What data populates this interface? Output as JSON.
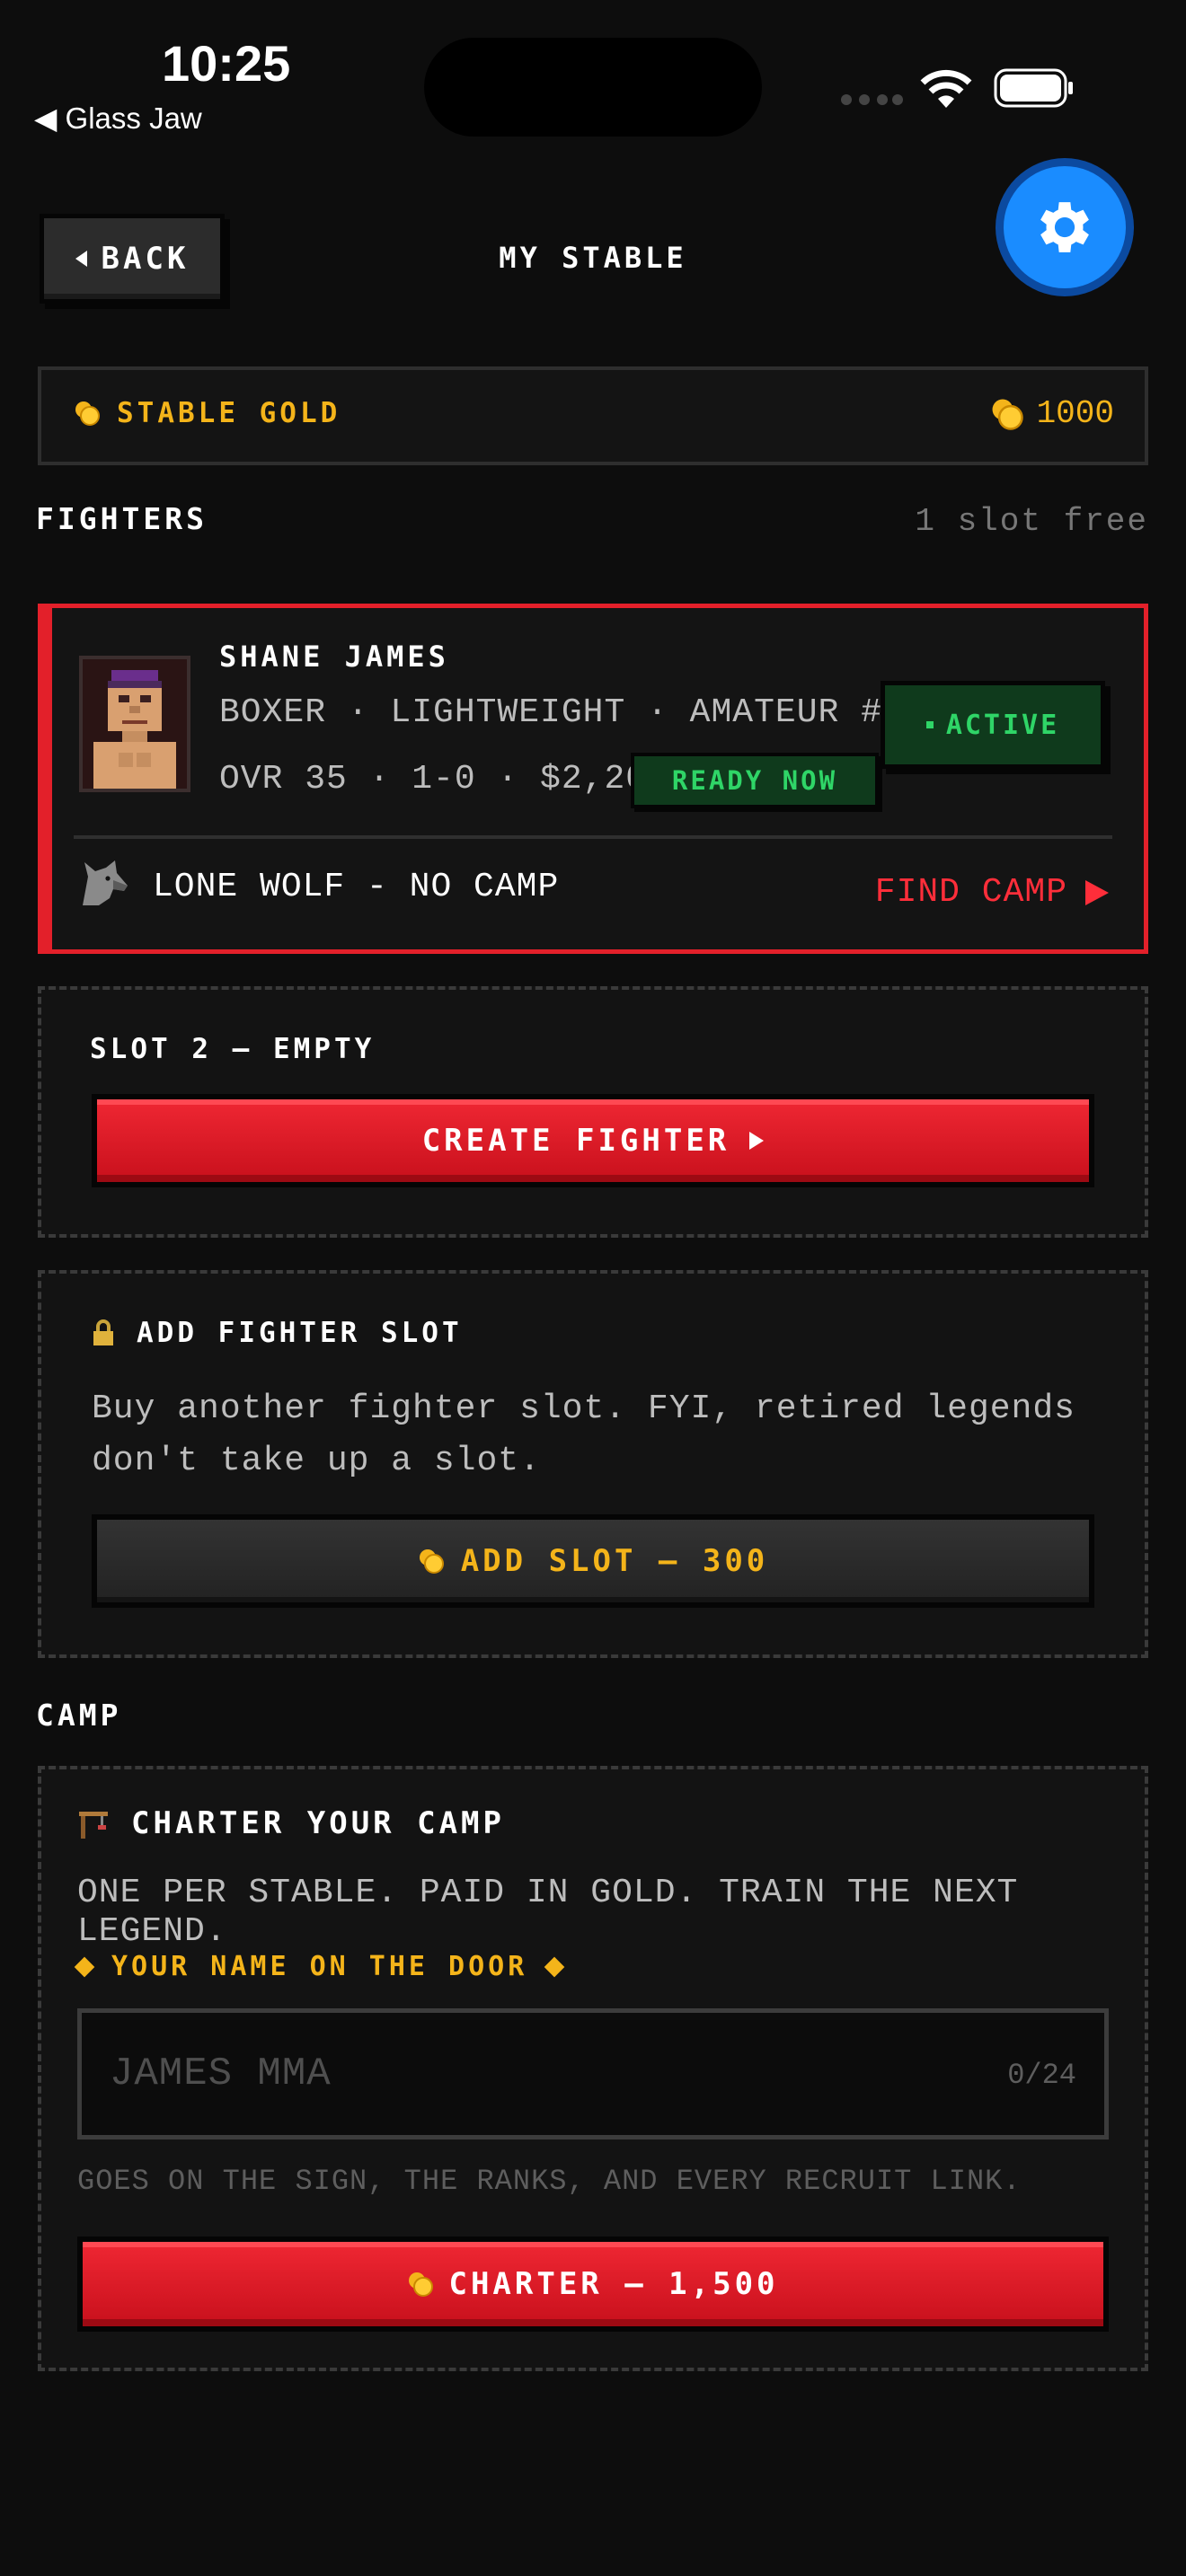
{
  "status_bar": {
    "time": "10:25",
    "back_app": "Glass Jaw"
  },
  "header": {
    "back_label": "BACK",
    "title": "MY STABLE"
  },
  "gold": {
    "label": "STABLE GOLD",
    "value": "1000"
  },
  "fighters_section": {
    "heading": "FIGHTERS",
    "slots_free": "1 slot free"
  },
  "fighter": {
    "name": "SHANE JAMES",
    "meta": "BOXER · LIGHTWEIGHT · AMATEUR #44",
    "stats": "OVR 35 · 1-0 · $2,200",
    "ready": "READY NOW",
    "status": "ACTIVE",
    "camp": "LONE WOLF - NO CAMP",
    "find_camp": "FIND CAMP"
  },
  "slot2": {
    "title": "SLOT 2 — EMPTY",
    "button": "CREATE FIGHTER"
  },
  "add_slot": {
    "title": "ADD FIGHTER SLOT",
    "description": "Buy another fighter slot. FYI, retired legends don't take up a slot.",
    "button": "ADD SLOT — 300"
  },
  "camp_section": {
    "heading": "CAMP",
    "title": "CHARTER YOUR CAMP",
    "subtitle": "ONE PER STABLE. PAID IN GOLD. TRAIN THE NEXT LEGEND.",
    "name_label": "YOUR NAME ON THE DOOR",
    "input_placeholder": "JAMES MMA",
    "input_count": "0/24",
    "hint": "GOES ON THE SIGN, THE RANKS, AND EVERY RECRUIT LINK.",
    "button": "CHARTER — 1,500"
  },
  "colors": {
    "accent_red": "#e3202a",
    "gold": "#f4b41a",
    "green": "#2fd567",
    "blue": "#1a8cff"
  },
  "icons": [
    "gear-icon",
    "coin-icon",
    "wolf-icon",
    "lock-icon",
    "crane-icon",
    "wifi-icon",
    "battery-icon"
  ]
}
